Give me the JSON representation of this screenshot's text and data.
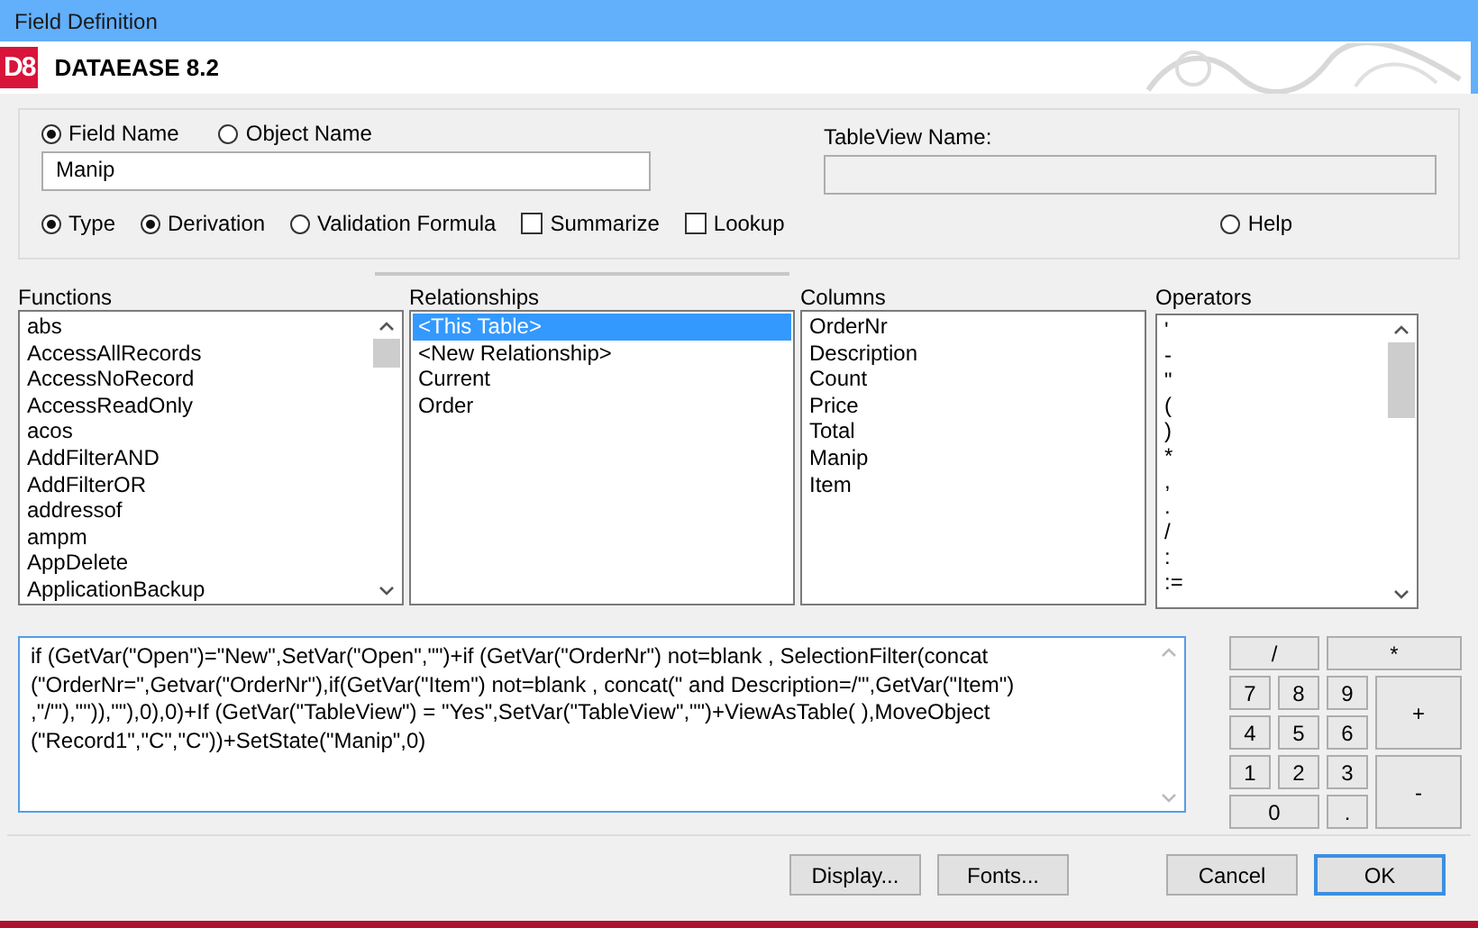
{
  "window": {
    "title": "Field Definition"
  },
  "header": {
    "logo": "D8",
    "product": "DATAEASE 8.2"
  },
  "name_options": [
    {
      "label": "Field Name",
      "selected": true
    },
    {
      "label": "Object Name",
      "selected": false
    }
  ],
  "field_name": {
    "value": "Manip"
  },
  "tableview": {
    "label": "TableView Name:"
  },
  "mode_options": [
    {
      "kind": "radio",
      "label": "Type",
      "selected": true
    },
    {
      "kind": "radio",
      "label": "Derivation",
      "selected": true
    },
    {
      "kind": "radio",
      "label": "Validation Formula",
      "selected": false
    },
    {
      "kind": "checkbox",
      "label": "Summarize",
      "checked": false
    },
    {
      "kind": "checkbox",
      "label": "Lookup",
      "checked": false
    }
  ],
  "help": {
    "label": "Help",
    "selected": false
  },
  "functions": {
    "title": "Functions",
    "items": [
      "abs",
      "AccessAllRecords",
      "AccessNoRecord",
      "AccessReadOnly",
      "acos",
      "AddFilterAND",
      "AddFilterOR",
      "addressof",
      "ampm",
      "AppDelete",
      "ApplicationBackup"
    ]
  },
  "relationships": {
    "title": "Relationships",
    "items": [
      {
        "label": "<This Table>",
        "selected": true
      },
      {
        "label": "<New Relationship>",
        "selected": false
      },
      {
        "label": "Current",
        "selected": false
      },
      {
        "label": "Order",
        "selected": false
      }
    ]
  },
  "columns": {
    "title": "Columns",
    "items": [
      "OrderNr",
      "Description",
      "Count",
      "Price",
      "Total",
      "Manip",
      "Item"
    ]
  },
  "operators": {
    "title": "Operators",
    "items": [
      "'",
      "-",
      "\"",
      "(",
      ")",
      "*",
      ",",
      ".",
      "/",
      ":",
      ":="
    ]
  },
  "formula": {
    "value": "if (GetVar(\"Open\")=\"New\",SetVar(\"Open\",\"\")+if (GetVar(\"OrderNr\") not=blank , SelectionFilter(concat (\"OrderNr=\",Getvar(\"OrderNr\"),if(GetVar(\"Item\") not=blank , concat(\" and Description=/'\",GetVar(\"Item\") ,\"/'\"),\"\")),\"\"),0),0)+If (GetVar(\"TableView\") = \"Yes\",SetVar(\"TableView\",\"\")+ViewAsTable( ),MoveObject (\"Record1\",\"C\",\"C\"))+SetState(\"Manip\",0)"
  },
  "keypad": [
    {
      "label": "/",
      "kind": "wide"
    },
    {
      "label": "*",
      "kind": "wide"
    },
    {
      "label": "7",
      "kind": "key"
    },
    {
      "label": "8",
      "kind": "key"
    },
    {
      "label": "9",
      "kind": "key"
    },
    {
      "label": "+",
      "kind": "tall"
    },
    {
      "label": "4",
      "kind": "key"
    },
    {
      "label": "5",
      "kind": "key"
    },
    {
      "label": "6",
      "kind": "key"
    },
    {
      "label": "1",
      "kind": "key"
    },
    {
      "label": "2",
      "kind": "key"
    },
    {
      "label": "3",
      "kind": "key"
    },
    {
      "label": "-",
      "kind": "tall"
    },
    {
      "label": "0",
      "kind": "wide"
    },
    {
      "label": ".",
      "kind": "key"
    }
  ],
  "buttons": [
    {
      "label": "Display...",
      "selected": false
    },
    {
      "label": "Fonts...",
      "selected": false
    },
    {
      "label": "Cancel",
      "selected": false
    },
    {
      "label": "OK",
      "selected": true
    }
  ]
}
